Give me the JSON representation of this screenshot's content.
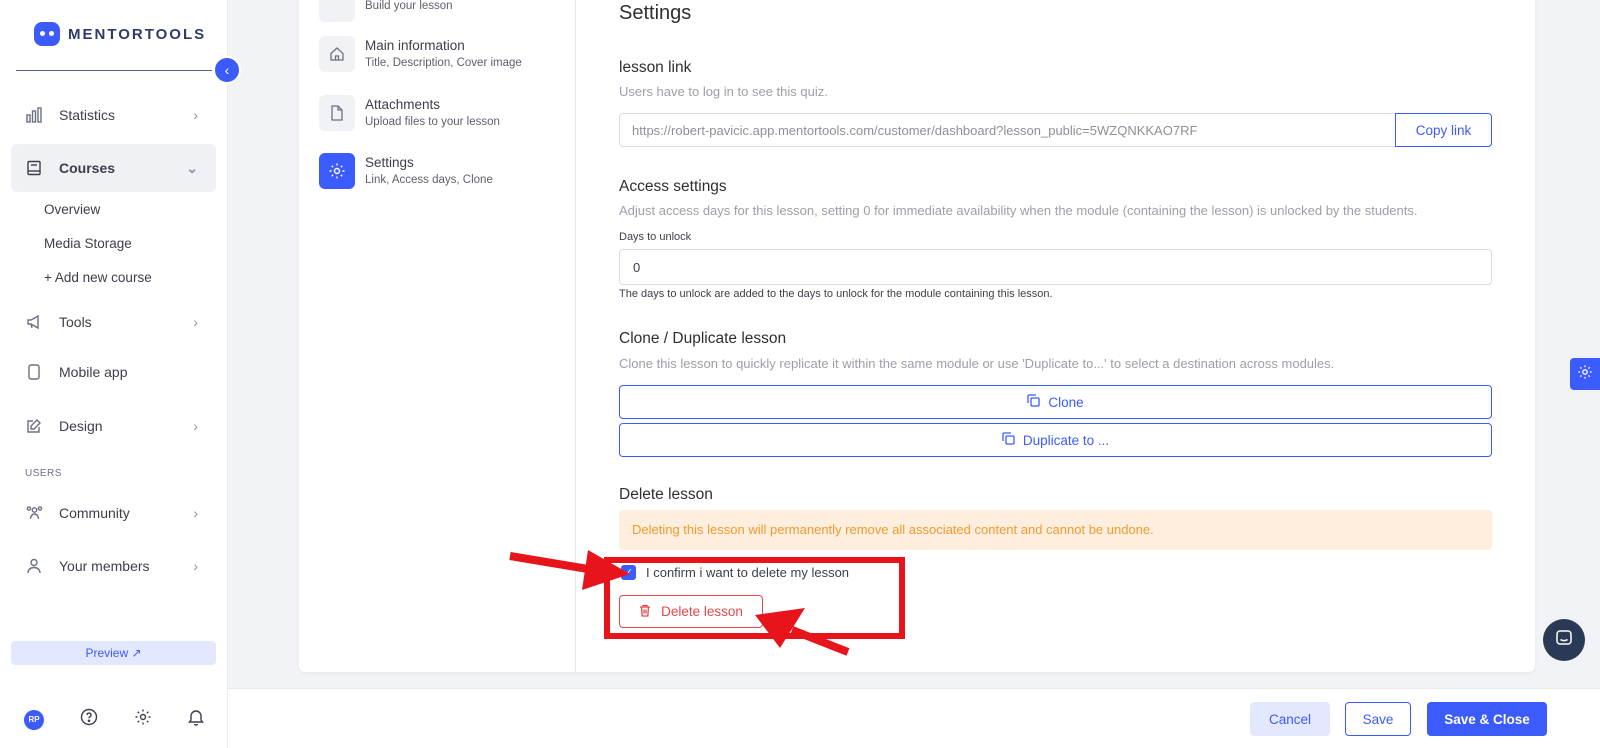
{
  "brand": {
    "name": "MENTORTOOLS"
  },
  "sidebar": {
    "items": [
      {
        "label": "Statistics"
      },
      {
        "label": "Courses"
      },
      {
        "label": "Tools"
      },
      {
        "label": "Mobile app"
      },
      {
        "label": "Design"
      },
      {
        "label": "Community"
      },
      {
        "label": "Your members"
      }
    ],
    "sub_items": [
      "Overview",
      "Media Storage",
      "+ Add new course"
    ],
    "section_users": "USERS",
    "preview_label": "Preview ↗",
    "avatar_initials": "RP"
  },
  "steps": [
    {
      "title": "",
      "desc": "Build your lesson"
    },
    {
      "title": "Main information",
      "desc": "Title, Description, Cover image"
    },
    {
      "title": "Attachments",
      "desc": "Upload files to your lesson"
    },
    {
      "title": "Settings",
      "desc": "Link, Access days, Clone"
    }
  ],
  "settings": {
    "heading": "Settings",
    "lesson_link": {
      "title": "lesson link",
      "desc": "Users have to log in to see this quiz.",
      "url": "https://robert-pavicic.app.mentortools.com/customer/dashboard?lesson_public=5WZQNKKAO7RF",
      "copy_label": "Copy link"
    },
    "access": {
      "title": "Access settings",
      "desc": "Adjust access days for this lesson, setting 0 for immediate availability when the module (containing the lesson) is unlocked by the students.",
      "days_label": "Days to unlock",
      "days_value": "0",
      "hint": "The days to unlock are added to the days to unlock for the module containing this lesson."
    },
    "clone": {
      "title": "Clone / Duplicate lesson",
      "desc": "Clone this lesson to quickly replicate it within the same module or use 'Duplicate to...' to select a destination across modules.",
      "clone_label": "Clone",
      "duplicate_label": "Duplicate to ..."
    },
    "delete": {
      "title": "Delete lesson",
      "warning": "Deleting this lesson will permanently remove all associated content and cannot be undone.",
      "confirm_label": "I confirm i want to delete my lesson",
      "confirm_checked": true,
      "delete_label": "Delete lesson"
    }
  },
  "footer": {
    "cancel_label": "Cancel",
    "save_label": "Save",
    "save_close_label": "Save & Close"
  },
  "colors": {
    "accent": "#3b5bfd",
    "danger": "#e5484d",
    "warning_bg": "#fdeedd",
    "warning_text": "#f29a2e",
    "annotation": "#e8141c"
  }
}
